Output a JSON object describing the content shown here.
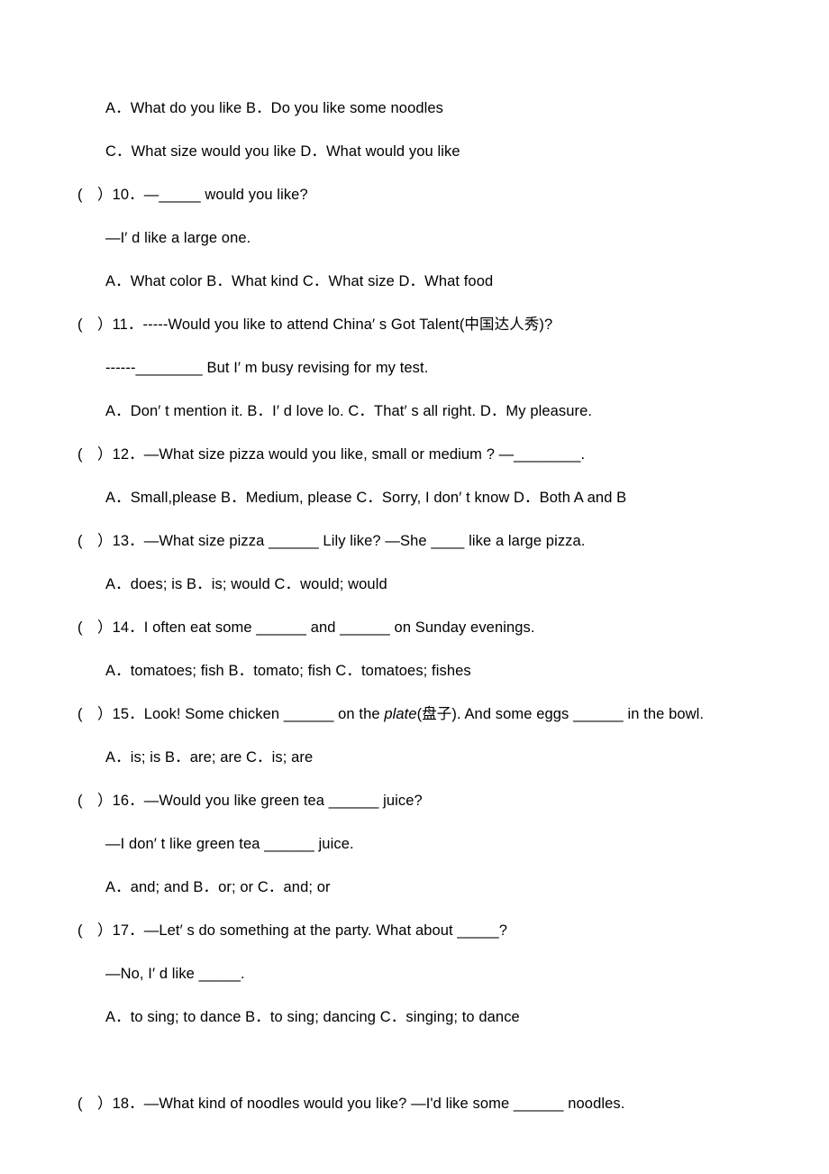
{
  "document": {
    "type": "english-exam-worksheet",
    "page_background": "#ffffff",
    "text_color": "#000000",
    "lines": [
      {
        "id": "q9-options-ab",
        "kind": "options",
        "indent": "indented",
        "text": "A．What do you like      B．Do you like some noodles"
      },
      {
        "id": "q9-options-cd",
        "kind": "options",
        "indent": "indented",
        "text": "C．What size would you like      D．What would you like"
      },
      {
        "id": "q10-stem",
        "kind": "question",
        "indent": "question",
        "marker": "(    )",
        "number": "10",
        "text": "）10．—_____ would you like?"
      },
      {
        "id": "q10-reply",
        "kind": "reply",
        "indent": "indented",
        "text": "—I′ d like a large one."
      },
      {
        "id": "q10-options",
        "kind": "options",
        "indent": "indented",
        "text": "A．What color      B．What kind      C．What size      D．What food"
      },
      {
        "id": "q11-stem",
        "kind": "question",
        "indent": "question",
        "marker": "(    )",
        "number": "11",
        "text": "）11．-----Would you like to attend China′ s Got Talent(中国达人秀)?"
      },
      {
        "id": "q11-reply",
        "kind": "reply",
        "indent": "indented",
        "text": "------________ But I′ m busy revising for my test."
      },
      {
        "id": "q11-options",
        "kind": "options",
        "indent": "indented",
        "text": "A．Don′ t mention it.      B．I′ d love lo.      C．That′ s all right.      D．My pleasure."
      },
      {
        "id": "q12-stem",
        "kind": "question",
        "indent": "question",
        "marker": "(    )",
        "number": "12",
        "text": "）12．—What size pizza would you like, small or medium ? —________."
      },
      {
        "id": "q12-options",
        "kind": "options",
        "indent": "indented",
        "text": "A．Small,please      B．Medium, please   C．Sorry, I don′ t know      D．Both A and B"
      },
      {
        "id": "q13-stem",
        "kind": "question",
        "indent": "question",
        "marker": "(    )",
        "number": "13",
        "text": "）13．—What size pizza ______ Lily like? —She ____ like a large pizza."
      },
      {
        "id": "q13-options",
        "kind": "options",
        "indent": "indented",
        "text": "A．does; is      B．is; would      C．would; would"
      },
      {
        "id": "q14-stem",
        "kind": "question",
        "indent": "question",
        "marker": "(    )",
        "number": "14",
        "text": "）14．I often eat some ______ and ______ on Sunday evenings."
      },
      {
        "id": "q14-options",
        "kind": "options",
        "indent": "indented",
        "text": "A．tomatoes; fish      B．tomato; fish      C．tomatoes; fishes"
      },
      {
        "id": "q15-stem",
        "kind": "question",
        "indent": "question",
        "marker": "(    )",
        "number": "15",
        "segments": [
          {
            "text": "）15．Look! Some chicken ______ on the ",
            "style": "normal"
          },
          {
            "text": "plate",
            "style": "italic"
          },
          {
            "text": "(盘子). And some eggs ______ in the bowl.",
            "style": "normal"
          }
        ]
      },
      {
        "id": "q15-options",
        "kind": "options",
        "indent": "indented",
        "text": "A．is; is      B．are; are      C．is; are"
      },
      {
        "id": "q16-stem",
        "kind": "question",
        "indent": "question",
        "marker": "(    )",
        "number": "16",
        "text": "）16．—Would you like green tea ______ juice?"
      },
      {
        "id": "q16-reply",
        "kind": "reply",
        "indent": "indented",
        "text": "—I don′ t like green tea ______ juice."
      },
      {
        "id": "q16-options",
        "kind": "options",
        "indent": "indented",
        "text": "A．and; and      B．or; or      C．and; or"
      },
      {
        "id": "q17-stem",
        "kind": "question",
        "indent": "question",
        "marker": "(    )",
        "number": "17",
        "text": "）17．—Let′ s do something at the party. What about _____?"
      },
      {
        "id": "q17-reply",
        "kind": "reply",
        "indent": "indented",
        "text": "—No, I′ d like _____."
      },
      {
        "id": "q17-options",
        "kind": "options",
        "indent": "indented",
        "text": "A．to sing; to dance      B．to sing; dancing      C．singing; to dance"
      },
      {
        "id": "q18-stem",
        "kind": "question",
        "indent": "question",
        "marker": "(    )",
        "number": "18",
        "text": "）18．—What kind of noodles would you like?    —I'd like some ______ noodles."
      }
    ]
  }
}
